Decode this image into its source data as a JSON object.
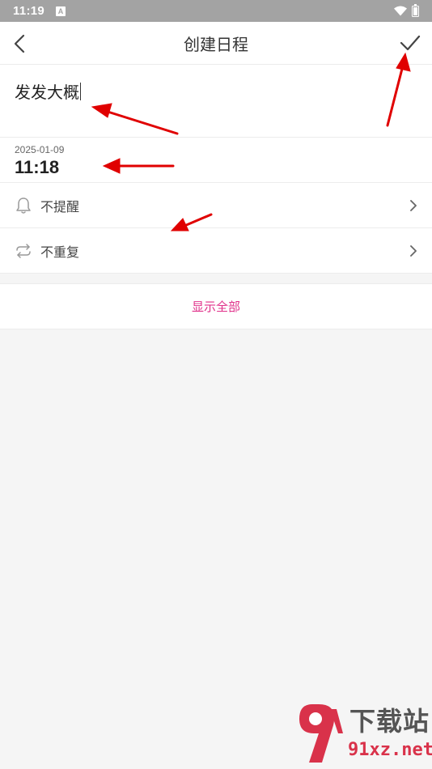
{
  "status_bar": {
    "time": "11:19",
    "notification_badge": "A"
  },
  "nav": {
    "title": "创建日程",
    "back_icon": "chevron-left-icon",
    "confirm_icon": "check-icon"
  },
  "schedule": {
    "title_value": "发发大概",
    "date": "2025-01-09",
    "time": "11:18"
  },
  "options": {
    "reminder_label": "不提醒",
    "repeat_label": "不重复"
  },
  "show_all": {
    "label": "显示全部",
    "color": "#e0308a"
  },
  "annotation_color": "#e00000",
  "watermark": {
    "cn": "下载站",
    "url": "91xz.net"
  }
}
